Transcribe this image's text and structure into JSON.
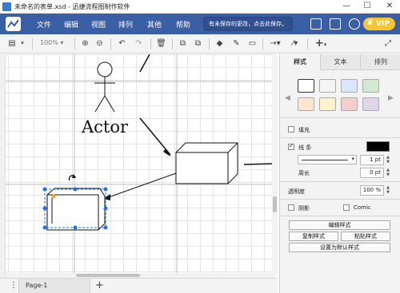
{
  "title_bar": {
    "title": "未命名的表单.xsd - 迅捷流程图制作软件",
    "minimize": "—",
    "maximize": "☐",
    "close": "✕"
  },
  "menu": {
    "items": [
      "文件",
      "编辑",
      "视图",
      "排列",
      "其他",
      "帮助"
    ],
    "unsaved_notice": "有未保存的更改，点击此保存。",
    "vip_label": "VIP"
  },
  "toolbar": {
    "zoom": "100%",
    "tools": [
      "page-layout-icon",
      "zoom-in-icon",
      "zoom-out-icon",
      "undo-icon",
      "redo-icon",
      "delete-icon",
      "to-front-icon",
      "to-back-icon",
      "fill-color-icon",
      "line-color-icon",
      "shadow-icon",
      "connection-icon",
      "waypoints-icon",
      "insert-icon",
      "fullscreen-icon"
    ]
  },
  "canvas": {
    "actor_label": "Actor"
  },
  "pages": {
    "menu": "⋮",
    "current": "Page-1",
    "add": "+"
  },
  "panel": {
    "tabs": [
      "样式",
      "文本",
      "排列"
    ],
    "active_tab": "样式",
    "swatches": [
      "#ffffff",
      "#f5f5f5",
      "#dae8fc",
      "#d5e8d4",
      "#ffe6cc",
      "#fff2cc",
      "#f8cecc",
      "#e1d5e7"
    ],
    "fill_label": "填充",
    "fill_checked": false,
    "line_label": "线 条",
    "line_checked": true,
    "line_color": "#000000",
    "line_width": "1 pt",
    "perimeter_label": "周长",
    "perimeter_value": "0 pt",
    "opacity_label": "透明度",
    "opacity_value": "100 %",
    "shadow_label": "阴影",
    "shadow_checked": false,
    "comic_label": "Comic",
    "comic_checked": false,
    "edit_style": "编辑样式",
    "copy_style": "复制样式",
    "paste_style": "粘贴样式",
    "set_default_style": "设置为默认样式"
  },
  "colors": {
    "menu_bar": "#3a5fa5",
    "selection": "#1e73e8",
    "panel_bg": "#f3f3f3"
  }
}
